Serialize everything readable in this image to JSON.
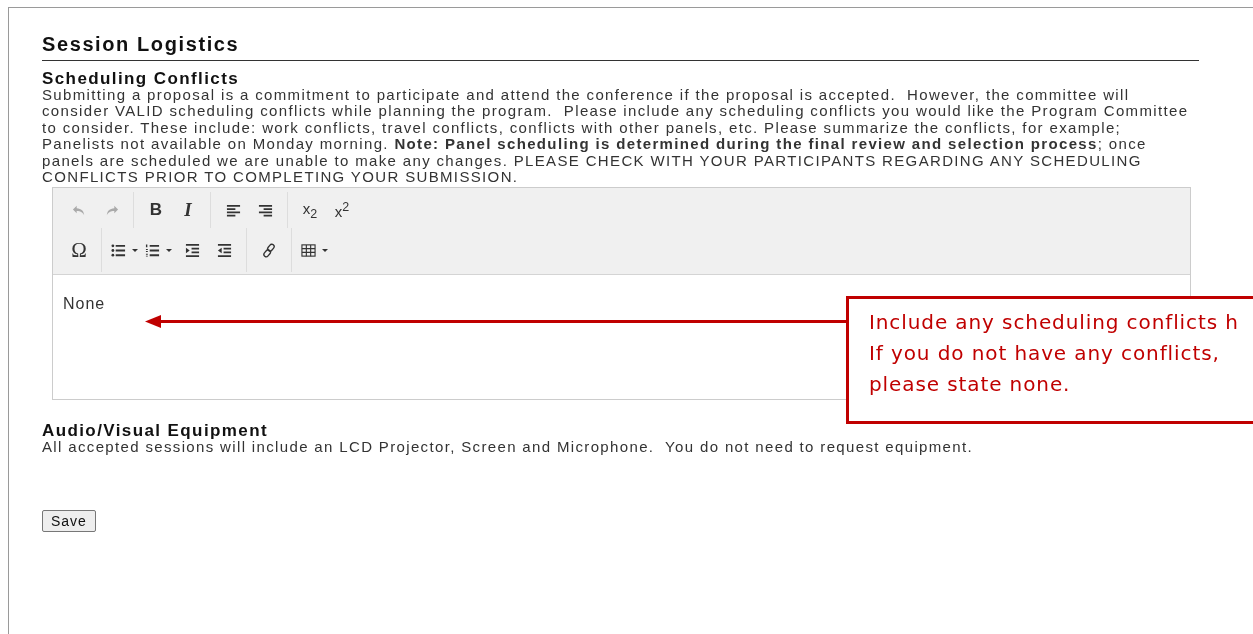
{
  "section_title": "Session Logistics",
  "scheduling": {
    "title": "Scheduling Conflicts",
    "text": "Submitting a proposal is a commitment to participate and attend the conference if the proposal is accepted.  However, the committee will consider VALID scheduling conflicts while planning the program.  Please include any scheduling conflicts you would like the Program Committee to consider. These include: work conflicts, travel conflicts, conflicts with other panels, etc. Please summarize the conflicts, for example; Panelists not available on Monday morning. **Note: Panel scheduling is determined during the final review and selection process**; once panels are scheduled we are unable to make any changes. PLEASE CHECK WITH YOUR PARTICIPANTS REGARDING ANY SCHEDULING CONFLICTS PRIOR TO COMPLETING YOUR SUBMISSION."
  },
  "editor": {
    "toolbar_rows": [
      [
        [
          {
            "kind": "undo",
            "disabled": true
          },
          {
            "kind": "redo",
            "disabled": true
          }
        ],
        [
          {
            "kind": "bold",
            "label": "B",
            "disabled": false
          },
          {
            "kind": "italic",
            "label": "I",
            "disabled": false
          }
        ],
        [
          {
            "kind": "align-left",
            "disabled": false
          },
          {
            "kind": "align-right",
            "disabled": false
          }
        ],
        [
          {
            "kind": "subscript",
            "label": "x$_{2}$",
            "disabled": false
          },
          {
            "kind": "superscript",
            "label": "x$^{2}$",
            "disabled": false
          }
        ]
      ],
      [
        [
          {
            "kind": "symbol",
            "label": "Ω",
            "disabled": false
          }
        ],
        [
          {
            "kind": "bullet-list",
            "disabled": false,
            "dropdown": true
          },
          {
            "kind": "numbered-list",
            "disabled": false,
            "dropdown": true
          },
          {
            "kind": "indent",
            "disabled": false
          },
          {
            "kind": "outdent",
            "disabled": false
          }
        ],
        [
          {
            "kind": "link",
            "disabled": false
          }
        ],
        [
          {
            "kind": "table",
            "disabled": false,
            "dropdown": true
          }
        ]
      ]
    ],
    "value": "None"
  },
  "callout": {
    "lines": [
      "Include any scheduling conflicts h",
      "If you do not have any conflicts,",
      "please state none."
    ]
  },
  "audio_visual": {
    "title": "Audio/Visual Equipment",
    "text": "All accepted sessions will include an LCD Projector, Screen and Microphone.  You do not need to request equipment."
  },
  "save_button": "Save"
}
